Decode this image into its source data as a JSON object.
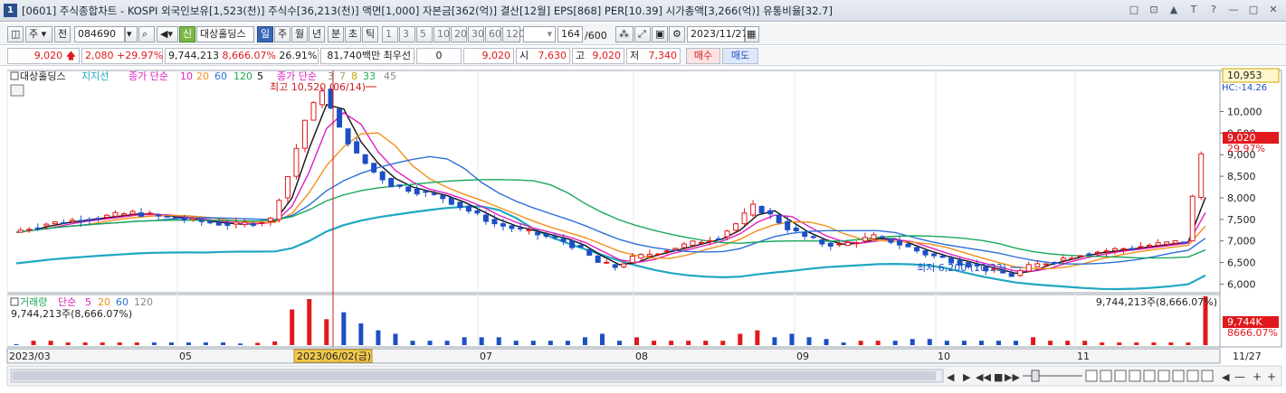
{
  "window": {
    "number": "1",
    "title": "[0601] 주식종합차트 - KOSPI 외국인보유[1,523(천)] 주식수[36,213(천)] 액면[1,000] 자본금[362(억)] 결산[12월] EPS[868] PER[10.39] 시가총액[3,266(억)] 유통비율[32.7]",
    "buttons": [
      "□",
      "⊡",
      "▲",
      "T",
      "?",
      "—",
      "□",
      "✕"
    ]
  },
  "toolbar": {
    "period_type": "주",
    "scope": "전",
    "code": "084690",
    "sin": "신",
    "stock_name": "대상홀딩스",
    "periods": [
      "일",
      "주",
      "월",
      "년",
      "분",
      "초",
      "틱"
    ],
    "selected_period": "일",
    "intervals": [
      "1",
      "3",
      "5",
      "10",
      "20",
      "30",
      "60",
      "120"
    ],
    "count": "164",
    "count_total": "/600",
    "date": "2023/11/27"
  },
  "quote": {
    "price": "9,020",
    "change": "2,080",
    "change_pct": "+29.97%",
    "volume": "9,744,213",
    "volume_ratio": "8,666.07%",
    "turnover": "26.91%",
    "amount": "81,740백만",
    "best_ask_label": "최우선",
    "best_ask_value": "0",
    "last": "9,020",
    "open_label": "시",
    "open": "7,630",
    "high_label": "고",
    "high": "9,020",
    "low_label": "저",
    "low": "7,340",
    "buy_label": "매수",
    "sell_label": "매도"
  },
  "price_legend": {
    "stock": "대상홀딩스",
    "envelope": "지지선",
    "ma_label": "종가 단순",
    "ma_periods": [
      "10",
      "20",
      "60",
      "120",
      "5"
    ],
    "ma_label2": "종가 단순",
    "ma_periods2": [
      "3",
      "7",
      "8",
      "33",
      "45"
    ]
  },
  "volume_legend": {
    "label": "거래량",
    "ma_label": "단순",
    "ma_periods": [
      "5",
      "20",
      "60",
      "120"
    ],
    "current": "9,744,213주(8,666.07%)",
    "current_right": "9,744,213주(8,666.07%)"
  },
  "annotations": {
    "high": "최고 10,520 (06/14)",
    "low": "최저 6,200 (10/23)",
    "cursor_date": "2023/06/02(금)"
  },
  "right_axis": {
    "top_price": "10,953",
    "hc_label": "HC:-14.26",
    "current_price": "9,020",
    "current_pct": "29.97%",
    "vol_badge": "9,744K",
    "vol_pct": "8666.07%"
  },
  "colors": {
    "up": "#e0191d",
    "down": "#1c4fc4",
    "ma5": "#111111",
    "ma10": "#e020c0",
    "ma20": "#f0901a",
    "ma60": "#2c6fd8",
    "ma120": "#1aa85a",
    "envelope": "#1fa8c0"
  },
  "chart_data": {
    "type": "candlestick",
    "y_ticks": [
      "10,000",
      "9,500",
      "9,000",
      "8,500",
      "8,000",
      "7,500",
      "7,000",
      "6,500",
      "6,000"
    ],
    "ylim": [
      5800,
      10953
    ],
    "x_labels": [
      "2023/03",
      "05",
      "07",
      "08",
      "09",
      "10",
      "11",
      "11/27"
    ],
    "price_path": [
      7200,
      7300,
      7400,
      7450,
      7500,
      7550,
      7600,
      7650,
      7600,
      7550,
      7500,
      7450,
      7400,
      7380,
      7420,
      7500,
      8500,
      9800,
      10520,
      9600,
      9000,
      8600,
      8300,
      8200,
      8100,
      8000,
      7800,
      7600,
      7400,
      7300,
      7200,
      7100,
      7000,
      6800,
      6500,
      6400,
      6600,
      6700,
      6800,
      6900,
      7000,
      7100,
      7400,
      7800,
      7600,
      7300,
      7100,
      6950,
      6900,
      7000,
      7100,
      7000,
      6850,
      6700,
      6600,
      6500,
      6400,
      6300,
      6200,
      6400,
      6500,
      6600,
      6700,
      6750,
      6800,
      6850,
      6900,
      6950,
      7000,
      9020
    ]
  },
  "bottom_bar": {
    "controls": [
      "◀",
      "▶",
      "◀◀",
      "■",
      "▶▶"
    ]
  }
}
